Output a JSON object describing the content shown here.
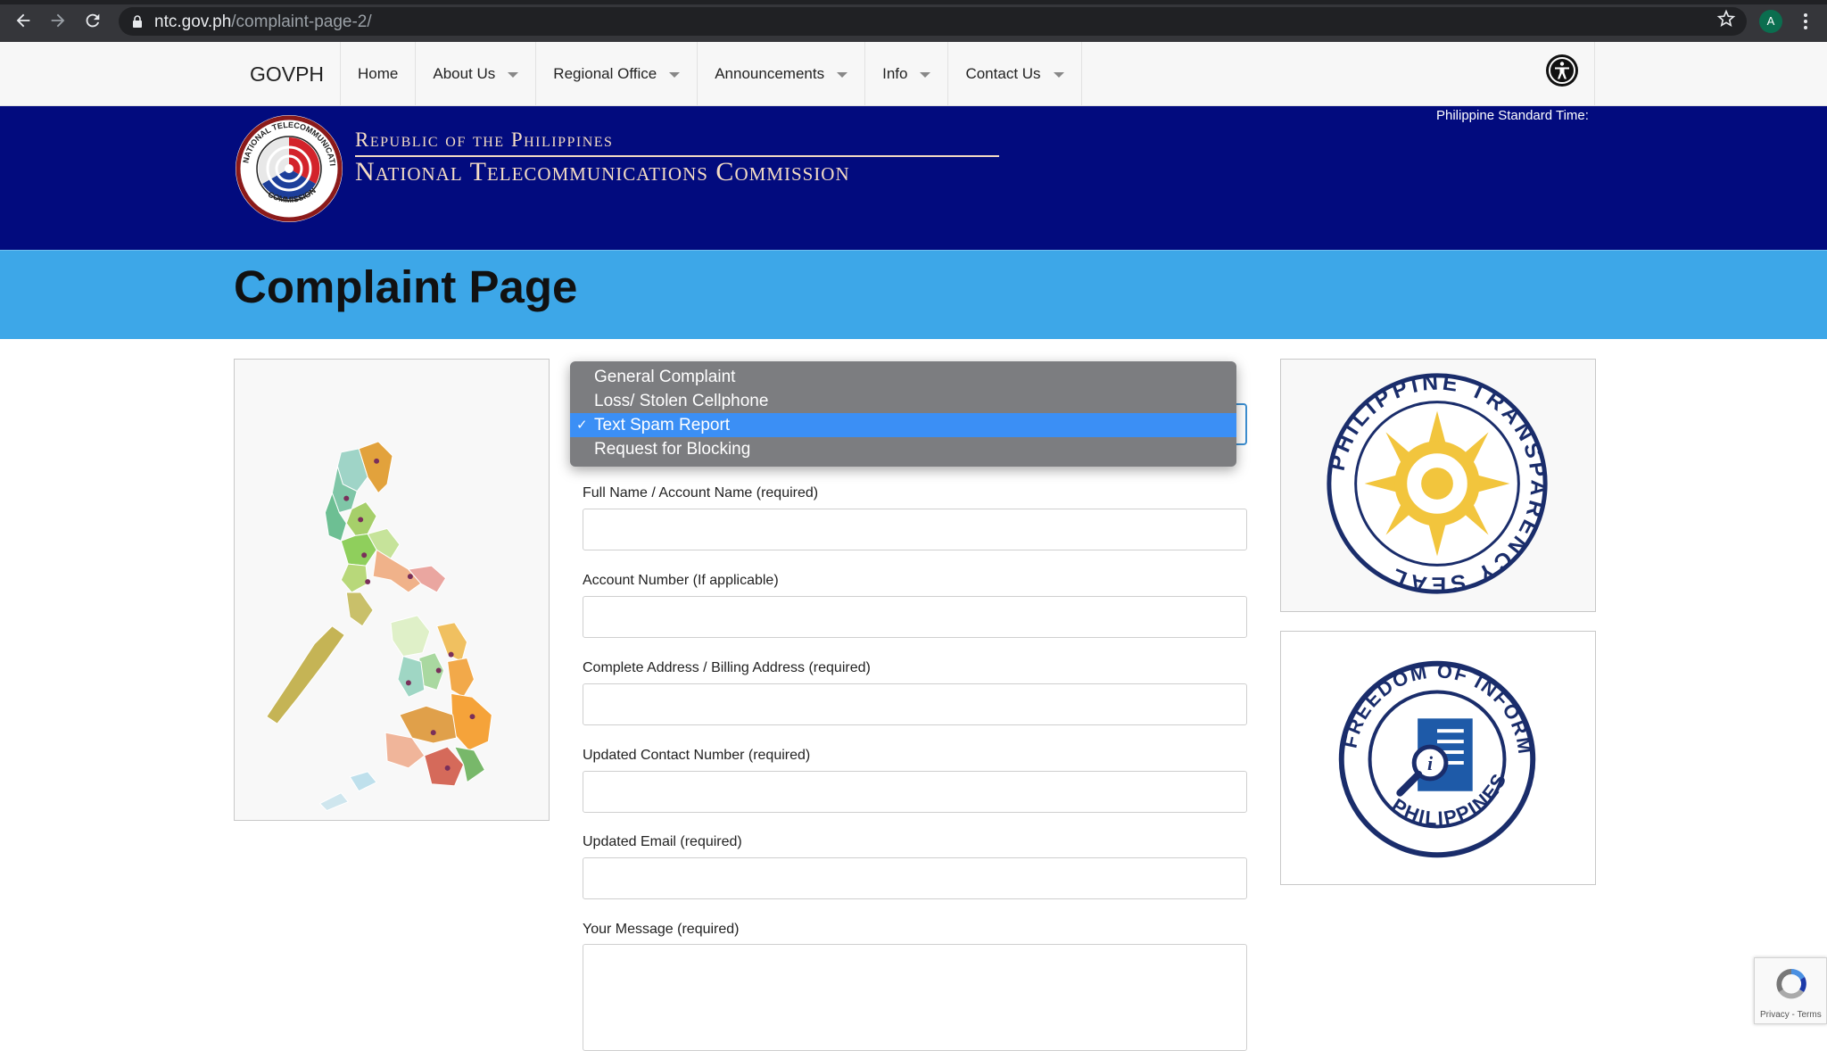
{
  "browser": {
    "url_host": "ntc.gov.ph",
    "url_path": "/complaint-page-2/",
    "profile_initial": "A"
  },
  "topbar": {
    "brand": "GOVPH",
    "menu": [
      {
        "label": "Home",
        "has_caret": false
      },
      {
        "label": "About Us",
        "has_caret": true
      },
      {
        "label": "Regional Office",
        "has_caret": true
      },
      {
        "label": "Announcements",
        "has_caret": true
      },
      {
        "label": "Info",
        "has_caret": true
      },
      {
        "label": "Contact Us",
        "has_caret": true
      }
    ]
  },
  "masthead": {
    "line1": "Republic of the Philippines",
    "line2": "National Telecommunications Commission",
    "pst_label": "Philippine Standard Time:",
    "seal_text": "NATIONAL TELECOMMUNICATIONS COMMISSION"
  },
  "page": {
    "title": "Complaint Page"
  },
  "form": {
    "dropdown_options": [
      {
        "label": "General Complaint",
        "selected": false
      },
      {
        "label": "Loss/ Stolen Cellphone",
        "selected": false
      },
      {
        "label": "Text Spam Report",
        "selected": true
      },
      {
        "label": "Request for Blocking",
        "selected": false
      }
    ],
    "fields": {
      "full_name": "Full Name / Account Name (required)",
      "account_number": "Account Number (If applicable)",
      "address": "Complete Address / Billing Address (required)",
      "contact": "Updated Contact Number (required)",
      "email": "Updated Email (required)",
      "message": "Your Message (required)"
    }
  },
  "side": {
    "transparency_seal": "PHILIPPINE TRANSPARENCY SEAL",
    "foi_seal_top": "FREEDOM OF INFORMATION",
    "foi_seal_bottom": "PHILIPPINES"
  },
  "recaptcha": {
    "text": "Privacy - Terms"
  },
  "colors": {
    "masthead": "#020b7e",
    "title_band": "#3da7e8",
    "dropdown_bg": "#7c7d80",
    "dropdown_selected": "#3b8ff5"
  }
}
